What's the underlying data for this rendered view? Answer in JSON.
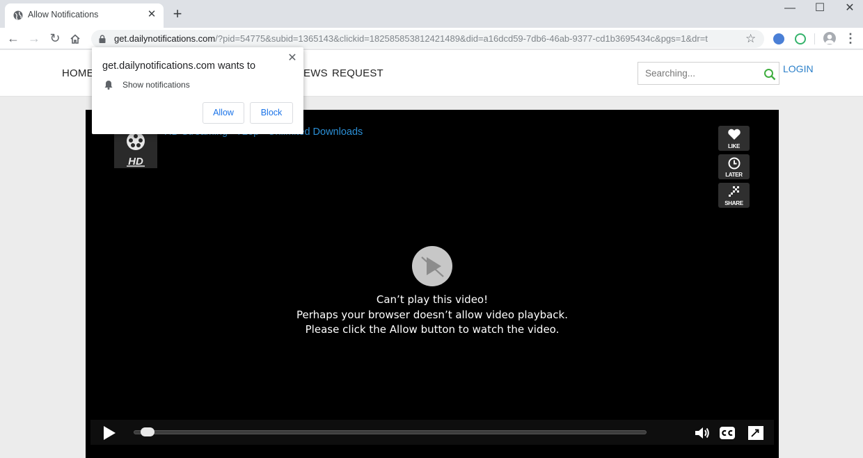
{
  "browser": {
    "tab_title": "Allow Notifications",
    "url_host": "get.dailynotifications.com",
    "url_path": "/?pid=54775&subid=1365143&clickid=182585853812421489&did=a16dcd59-7db6-46ab-9377-cd1b3695434c&pgs=1&dr=t"
  },
  "header": {
    "nav": [
      "HOME",
      "EWS",
      "REQUEST"
    ],
    "search_placeholder": "Searching...",
    "login_label": "LOGIN"
  },
  "player": {
    "title": "HD Streaming - 720p - Unlimited Downloads",
    "side_buttons": [
      "LIKE",
      "LATER",
      "SHARE"
    ],
    "messages": [
      "Can’t play this video!",
      "Perhaps your browser doesn’t allow video playback.",
      "Please click the Allow button to watch the video."
    ],
    "progress": 0.03
  },
  "popup": {
    "title": "get.dailynotifications.com wants to",
    "permission": "Show notifications",
    "allow_label": "Allow",
    "block_label": "Block"
  },
  "colors": {
    "link_blue": "#2b8fd6",
    "chrome_blue": "#1a73e8"
  }
}
